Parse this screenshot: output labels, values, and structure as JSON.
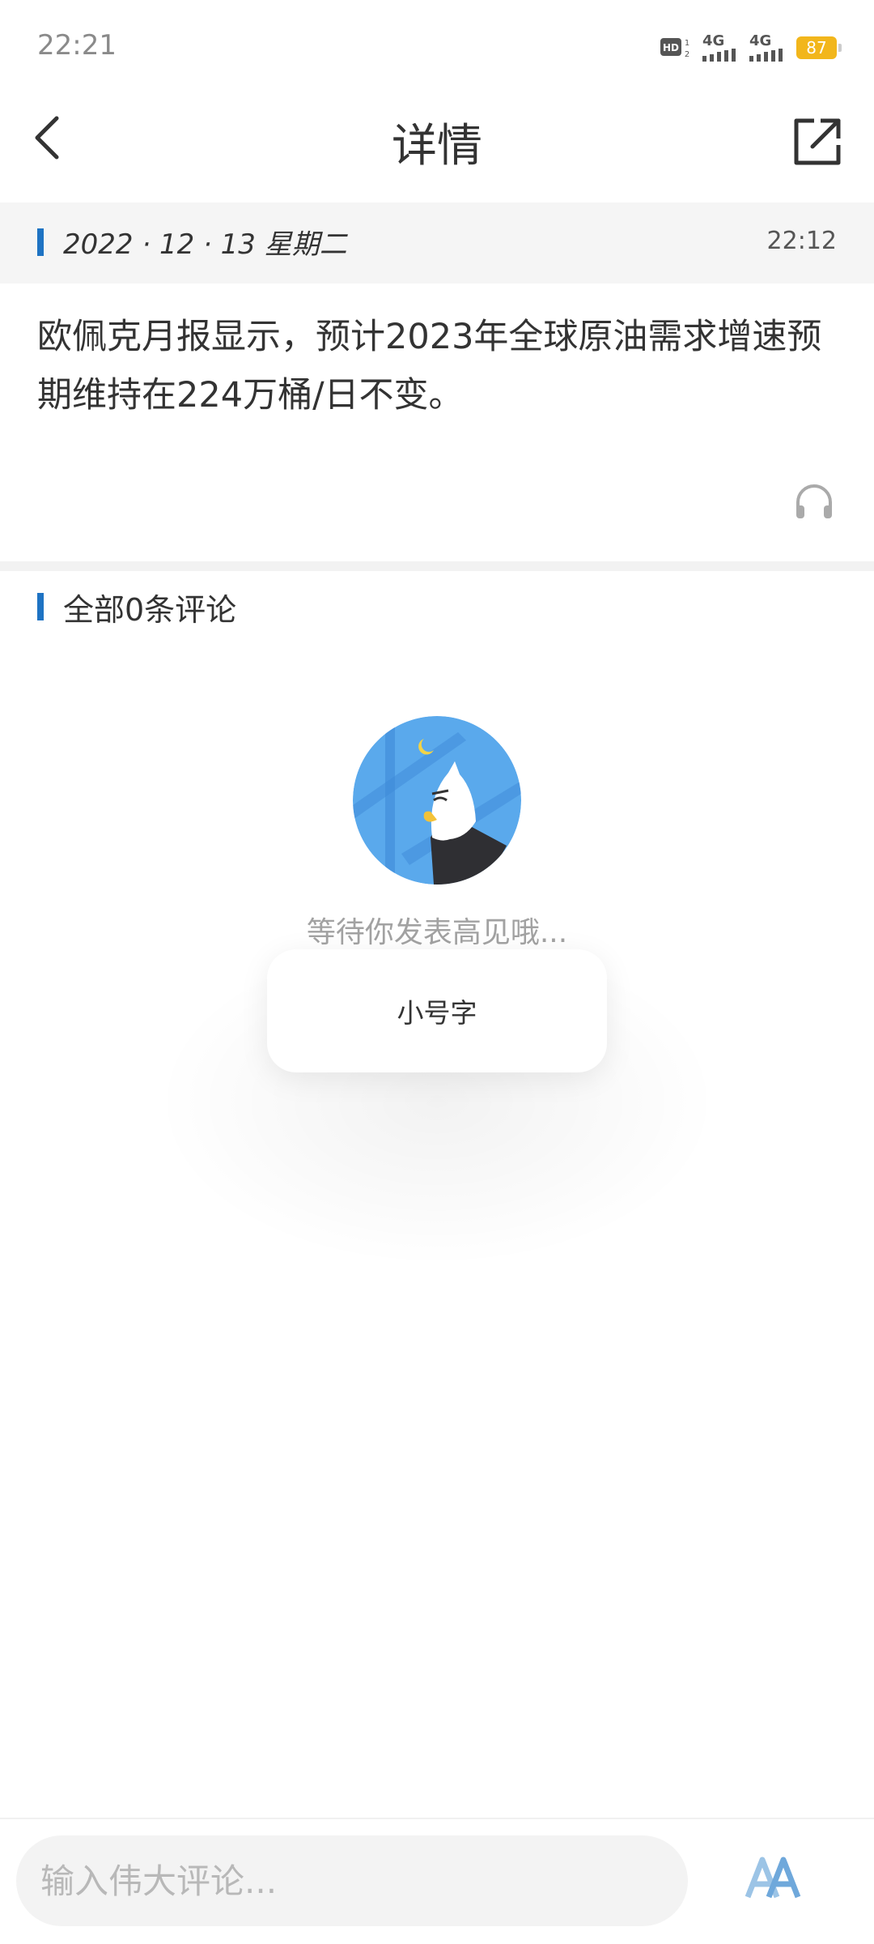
{
  "status_bar": {
    "time": "22:21",
    "net1": "4G",
    "net2": "4G",
    "battery": "87",
    "battery_color": "#f2b61b"
  },
  "header": {
    "title": "详情"
  },
  "news": {
    "date": "2022 · 12 · 13  星期二",
    "time": "22:12",
    "content": "欧佩克月报显示，预计2023年全球原油需求增速预期维持在224万桶/日不变。",
    "accent_color": "#1e73c3"
  },
  "comments": {
    "title": "全部0条评论",
    "empty_text": "等待你发表高见哦..."
  },
  "popup": {
    "label": "小号字"
  },
  "bottom_bar": {
    "input_placeholder": "输入伟大评论..."
  },
  "icons": {
    "back": "chevron-left-icon",
    "share": "share-icon",
    "audio": "headphones-icon",
    "font_size": "font-size-icon",
    "hd": "hd-icon"
  }
}
